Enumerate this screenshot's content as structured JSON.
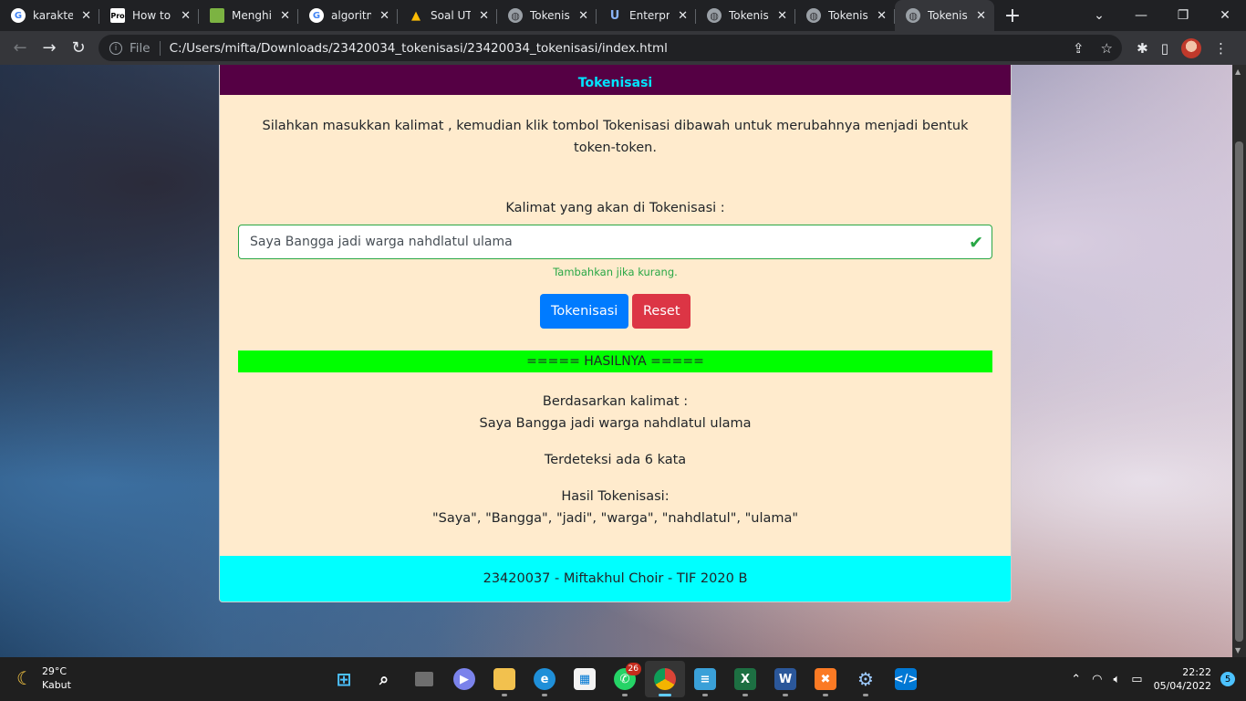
{
  "browser": {
    "tabs": [
      {
        "title": "karakter",
        "favicon": "google-icon",
        "active": false
      },
      {
        "title": "How to",
        "favicon": "pro-icon",
        "active": false
      },
      {
        "title": "Menghit",
        "favicon": "green-doc-icon",
        "active": false
      },
      {
        "title": "algoritm",
        "favicon": "google-icon",
        "active": false
      },
      {
        "title": "Soal UTS",
        "favicon": "drive-icon",
        "active": false
      },
      {
        "title": "Tokenisa",
        "favicon": "globe-icon",
        "active": false
      },
      {
        "title": "Enterpri",
        "favicon": "u-icon",
        "active": false
      },
      {
        "title": "Tokenisa",
        "favicon": "globe-icon",
        "active": false
      },
      {
        "title": "Tokenisa",
        "favicon": "globe-icon",
        "active": false
      },
      {
        "title": "Tokenisa",
        "favicon": "globe-icon",
        "active": true
      }
    ],
    "address": {
      "scheme_label": "File",
      "url": "C:/Users/mifta/Downloads/23420034_tokenisasi/23420034_tokenisasi/index.html"
    }
  },
  "page": {
    "header_title": "Tokenisasi",
    "intro": "Silahkan masukkan kalimat , kemudian klik tombol Tokenisasi dibawah untuk merubahnya menjadi bentuk token-token.",
    "input_label": "Kalimat yang akan di Tokenisasi :",
    "input_value": "Saya Bangga jadi warga nahdlatul ulama",
    "hint": "Tambahkan jika kurang.",
    "buttons": {
      "tokenize": "Tokenisasi",
      "reset": "Reset"
    },
    "result_header": "===== HASILNYA =====",
    "result": {
      "sentence_label": "Berdasarkan kalimat :",
      "sentence": "Saya Bangga jadi warga nahdlatul ulama",
      "count_text": "Terdeteksi ada 6 kata",
      "tokens_label": "Hasil Tokenisasi:",
      "tokens": "\"Saya\", \"Bangga\", \"jadi\", \"warga\", \"nahdlatul\", \"ulama\""
    },
    "footer": "23420037 - Miftakhul Choir - TIF 2020 B"
  },
  "taskbar": {
    "weather": {
      "temp": "29°C",
      "condition": "Kabut"
    },
    "apps": [
      {
        "name": "start-icon"
      },
      {
        "name": "search-icon"
      },
      {
        "name": "task-view-icon"
      },
      {
        "name": "chat-icon"
      },
      {
        "name": "file-explorer-icon"
      },
      {
        "name": "edge-icon"
      },
      {
        "name": "store-icon"
      },
      {
        "name": "whatsapp-icon",
        "badge": "26"
      },
      {
        "name": "chrome-icon",
        "active": true
      },
      {
        "name": "notepad-icon"
      },
      {
        "name": "excel-icon"
      },
      {
        "name": "word-icon"
      },
      {
        "name": "xampp-icon"
      },
      {
        "name": "settings-icon"
      },
      {
        "name": "vscode-icon"
      }
    ],
    "clock": {
      "time": "22:22",
      "date": "05/04/2022"
    },
    "notifications": "5"
  },
  "colors": {
    "header_bg": "#550044",
    "header_text": "#00e5ff",
    "card_bg": "#ffebcd",
    "result_bar": "#00ff00",
    "footer_bg": "#00ffff",
    "primary": "#007bff",
    "danger": "#dc3545",
    "success": "#28a745"
  }
}
